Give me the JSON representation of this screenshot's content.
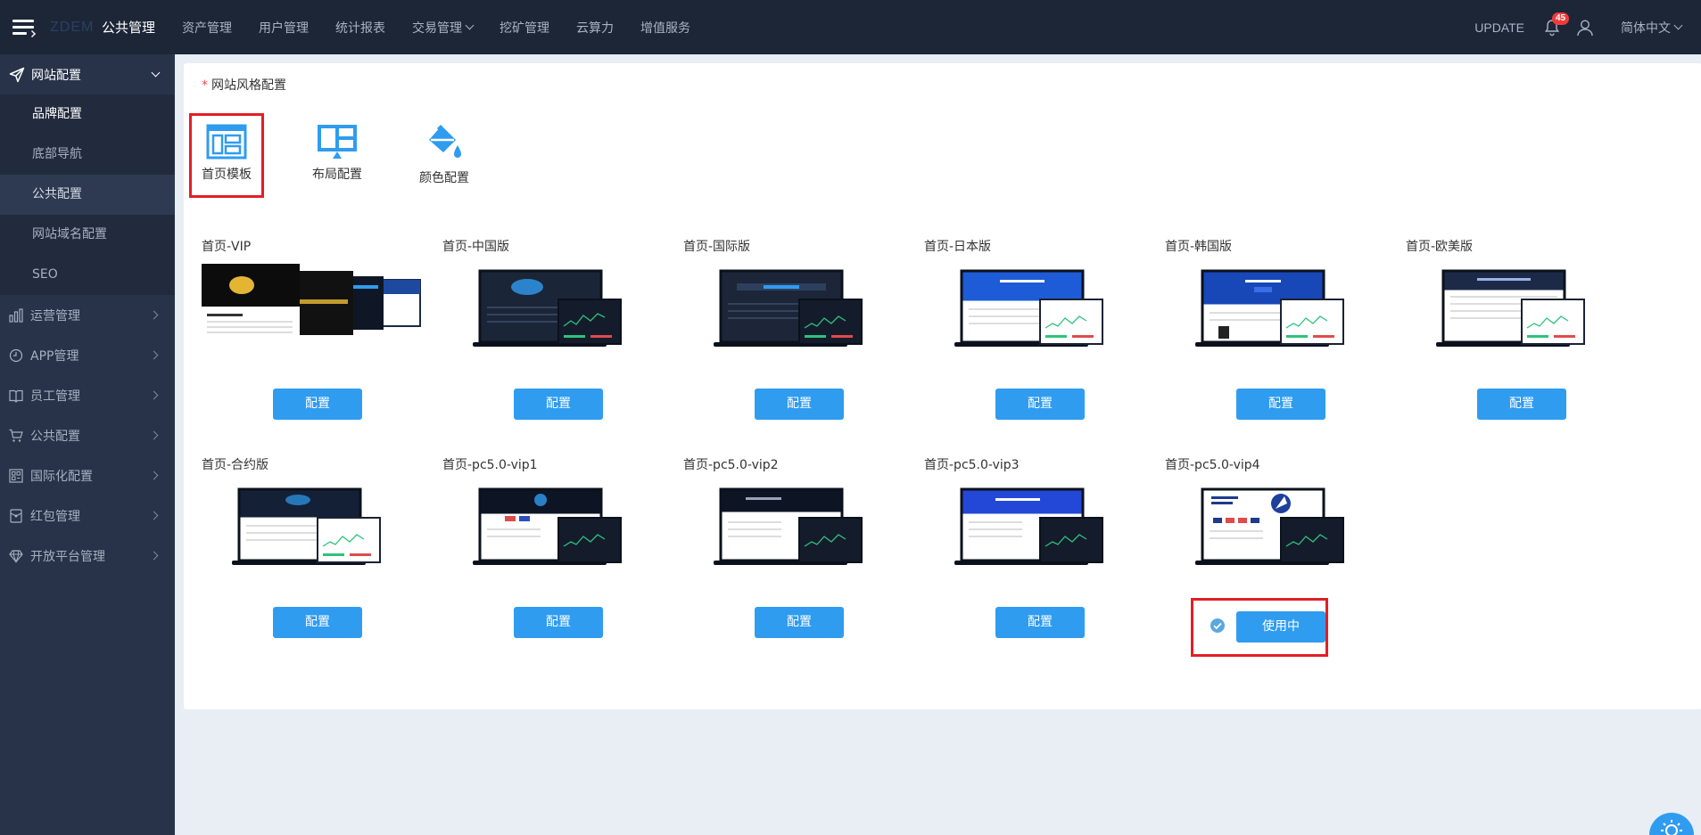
{
  "topbar": {
    "logo": "ZDEM",
    "nav": [
      {
        "label": "公共管理",
        "active": true,
        "has_dropdown": false
      },
      {
        "label": "资产管理",
        "active": false,
        "has_dropdown": false
      },
      {
        "label": "用户管理",
        "active": false,
        "has_dropdown": false
      },
      {
        "label": "统计报表",
        "active": false,
        "has_dropdown": false
      },
      {
        "label": "交易管理",
        "active": false,
        "has_dropdown": true
      },
      {
        "label": "挖矿管理",
        "active": false,
        "has_dropdown": false
      },
      {
        "label": "云算力",
        "active": false,
        "has_dropdown": false
      },
      {
        "label": "增值服务",
        "active": false,
        "has_dropdown": false
      }
    ],
    "update_label": "UPDATE",
    "notification_count": "45",
    "language": "简体中文"
  },
  "sidebar": {
    "open_group": {
      "label": "网站配置",
      "icon": "send-icon",
      "items": [
        {
          "label": "品牌配置",
          "state": "current"
        },
        {
          "label": "底部导航",
          "state": "normal"
        },
        {
          "label": "公共配置",
          "state": "hover"
        },
        {
          "label": "网站域名配置",
          "state": "normal"
        },
        {
          "label": "SEO",
          "state": "normal"
        }
      ]
    },
    "groups": [
      {
        "label": "运营管理",
        "icon": "bar-chart-icon"
      },
      {
        "label": "APP管理",
        "icon": "clock-icon"
      },
      {
        "label": "员工管理",
        "icon": "book-icon"
      },
      {
        "label": "公共配置",
        "icon": "cart-icon"
      },
      {
        "label": "国际化配置",
        "icon": "grid-icon"
      },
      {
        "label": "红包管理",
        "icon": "red-packet-icon"
      },
      {
        "label": "开放平台管理",
        "icon": "diamond-icon"
      }
    ]
  },
  "panel": {
    "title_mark": "*",
    "title": "网站风格配置",
    "style_tabs": [
      {
        "label": "首页模板",
        "icon": "template-icon",
        "selected": true
      },
      {
        "label": "布局配置",
        "icon": "layout-icon",
        "selected": false
      },
      {
        "label": "颜色配置",
        "icon": "paint-bucket-icon",
        "selected": false
      }
    ],
    "templates": [
      {
        "title": "首页-VIP",
        "button": "配置",
        "theme": "multi"
      },
      {
        "title": "首页-中国版",
        "button": "配置",
        "theme": "dark"
      },
      {
        "title": "首页-国际版",
        "button": "配置",
        "theme": "dark"
      },
      {
        "title": "首页-日本版",
        "button": "配置",
        "theme": "blue"
      },
      {
        "title": "首页-韩国版",
        "button": "配置",
        "theme": "blue"
      },
      {
        "title": "首页-欧美版",
        "button": "配置",
        "theme": "light"
      },
      {
        "title": "首页-合约版",
        "button": "配置",
        "theme": "light"
      },
      {
        "title": "首页-pc5.0-vip1",
        "button": "配置",
        "theme": "dark"
      },
      {
        "title": "首页-pc5.0-vip2",
        "button": "配置",
        "theme": "dark"
      },
      {
        "title": "首页-pc5.0-vip3",
        "button": "配置",
        "theme": "blue"
      },
      {
        "title": "首页-pc5.0-vip4",
        "button": "使用中",
        "theme": "light",
        "in_use": true
      }
    ]
  },
  "colors": {
    "topbar_bg": "#1d2637",
    "sidebar_bg": "#28334a",
    "accent": "#2f9cf0",
    "highlight_border": "#e31e25"
  }
}
